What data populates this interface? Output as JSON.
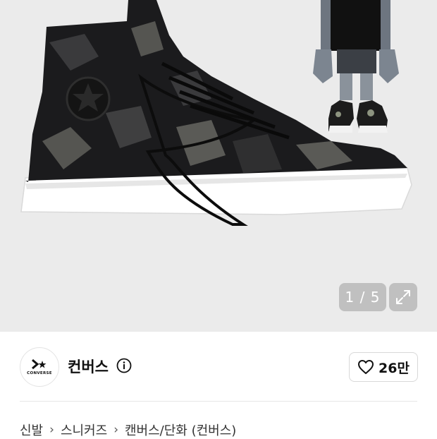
{
  "gallery": {
    "counter": "1 / 5",
    "expand_icon": "expand-arrows-icon",
    "image_subject": "sneaker-product-image"
  },
  "brand": {
    "logo_text": "CONVERSE",
    "name": "컨버스",
    "info_icon": "info-icon"
  },
  "like": {
    "icon": "heart-outline-icon",
    "count": "26만"
  },
  "breadcrumb": {
    "items": [
      "신발",
      "스니커즈",
      "캔버스/단화 (컨버스)"
    ],
    "separator_icon": "chevron-right-icon"
  }
}
